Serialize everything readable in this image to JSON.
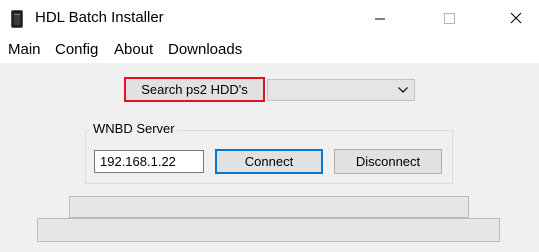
{
  "window": {
    "title": "HDL Batch Installer",
    "icon": "ps2-console-icon",
    "caption_buttons": [
      "minimize",
      "maximize",
      "close"
    ]
  },
  "menu": {
    "items": [
      "Main",
      "Config",
      "About",
      "Downloads"
    ]
  },
  "search": {
    "button_label": "Search ps2 HDD's",
    "highlight_color": "#e0121e",
    "drive_select_value": ""
  },
  "wnbd": {
    "group_label": "WNBD Server",
    "ip_value": "192.168.1.22",
    "connect_label": "Connect",
    "disconnect_label": "Disconnect",
    "focus_color": "#0078d7"
  },
  "progress": {
    "primary_value": 0,
    "secondary_value": 0
  }
}
